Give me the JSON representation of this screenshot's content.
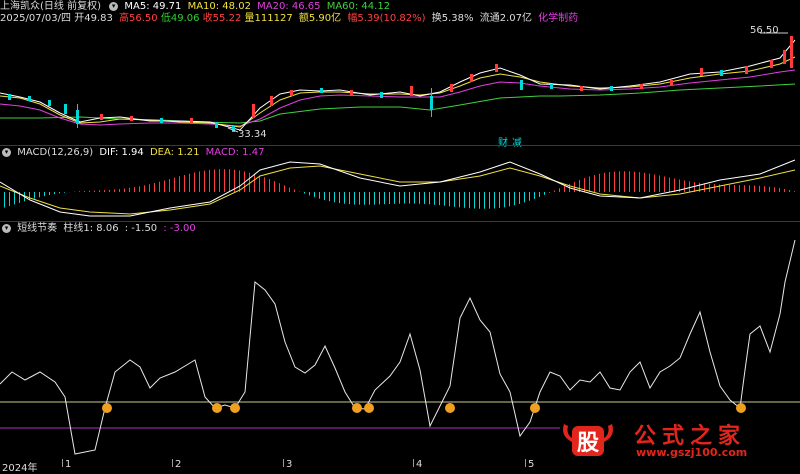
{
  "header": {
    "stock_name": "上海凯众(日线 前复权)",
    "ma": [
      {
        "label": "MA5: 49.71",
        "color": "#ffffff"
      },
      {
        "label": "MA10: 48.02",
        "color": "#f0e040"
      },
      {
        "label": "MA20: 46.65",
        "color": "#e040e0"
      },
      {
        "label": "MA60: 44.12",
        "color": "#40d040"
      }
    ]
  },
  "quote": {
    "date": "2025/07/03/四",
    "open": "开49.83",
    "high": "高56.50",
    "low": "低49.06",
    "close": "收55.22",
    "volume": "量111127",
    "amount": "额5.90亿",
    "change": "幅5.39(10.82%)",
    "turnover": "换5.38%",
    "float": "流通2.07亿",
    "industry": "化学制药"
  },
  "price_panel": {
    "high_marker": "56.50",
    "low_marker": "33.34",
    "finance_tag_1": "财",
    "finance_tag_2": "减",
    "colors": {
      "up": "#ff3c3c",
      "down": "#00d8d8",
      "bg": "#000000"
    }
  },
  "macd_panel": {
    "title": "MACD(12,26,9)",
    "dif": "DIF: 1.94",
    "dea": "DEA: 1.21",
    "macd": "MACD: 1.47"
  },
  "indicator_panel": {
    "title": "短线节奏",
    "bar_label": "柱线1: 8.06",
    "value2": ": -1.50",
    "value3": ": -3.00"
  },
  "time_axis": {
    "year_label": "2024年",
    "months": [
      "1",
      "2",
      "3",
      "4",
      "5"
    ]
  },
  "watermark": {
    "logo_char": "股",
    "site_name": "公式之家",
    "url": "www.gszj100.com"
  }
}
